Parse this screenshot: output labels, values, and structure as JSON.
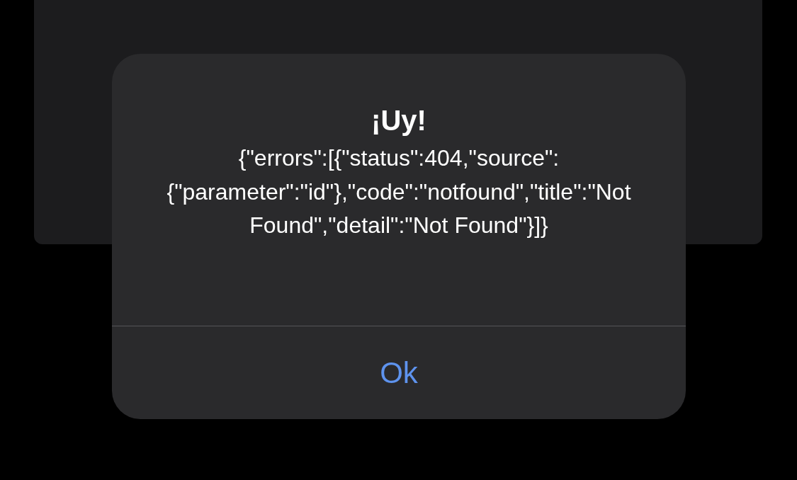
{
  "alert": {
    "title": "¡Uy!",
    "message": "{\"errors\":[{\"status\":404,\"source\":{\"parameter\":\"id\"},\"code\":\"notfound\",\"title\":\"Not Found\",\"detail\":\"Not Found\"}]}",
    "buttons": [
      {
        "label": "Ok"
      }
    ]
  }
}
